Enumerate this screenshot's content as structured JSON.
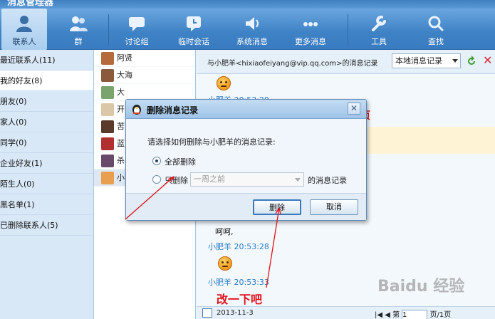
{
  "window": {
    "title": "消息管理器"
  },
  "toolbar": {
    "items": [
      {
        "label": "联系人",
        "icon": "contact-person-icon"
      },
      {
        "label": "群",
        "icon": "group-icon"
      },
      {
        "label": "讨论组",
        "icon": "discussion-icon"
      },
      {
        "label": "临时会话",
        "icon": "temp-chat-icon"
      },
      {
        "label": "系统消息",
        "icon": "speaker-icon"
      },
      {
        "label": "更多消息",
        "icon": "more-dots-icon"
      },
      {
        "label": "工具",
        "icon": "wrench-icon"
      },
      {
        "label": "查找",
        "icon": "magnifier-icon"
      }
    ]
  },
  "categories": [
    "最近联系人(11)",
    "我的好友(8)",
    "朋友(0)",
    "家人(0)",
    "同学(0)",
    "企业好友(1)",
    "陌生人(0)",
    "黑名单(1)",
    "已删除联系人(5)"
  ],
  "friends": [
    "阿贤",
    "大海",
    "大",
    "开",
    "苦",
    "蓝",
    "杀",
    "小"
  ],
  "chat": {
    "header_text": "与小肥羊<hixiaofeiyang@vip.qq.com>的消息记录",
    "record_select": "本地消息记录",
    "messages": [
      {
        "meta": "小肥羊 20:53:28",
        "text": "呵呵,"
      },
      {
        "meta": "小肥羊 20:53:33",
        "text": ""
      }
    ],
    "partial_meta_top": "小肥羊 20:53:20",
    "footer_date": "2013-11-3",
    "pager": {
      "page_prefix": "第",
      "page_value": "1",
      "page_suffix": "页/1页"
    }
  },
  "dialog": {
    "title": "删除消息记录",
    "prompt": "请选择如何删除与小肥羊的消息记录:",
    "option_all": "全部删除",
    "option_partial": "只删除",
    "partial_select": "一周之前",
    "partial_suffix": "的消息记录",
    "delete_button": "删除",
    "cancel_button": "取消"
  },
  "annotations": {
    "edit_note": "改一下吧",
    "top_fragment": "页"
  },
  "watermark": "Baidu 经验",
  "colors": {
    "toolbar": "#3e82c6",
    "annotation": "#e0101a",
    "meta_blue": "#2a7bc7"
  }
}
